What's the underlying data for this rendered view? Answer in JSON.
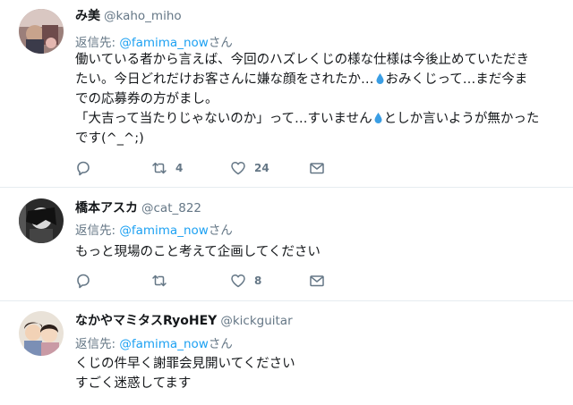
{
  "tweets": [
    {
      "name": "み美",
      "handle": "@kaho_miho",
      "reply_prefix": "返信先: ",
      "reply_to": "@famima_now",
      "reply_suffix": "さん",
      "lines": [
        "働いている者から言えば、今回のハズレくじの様な仕様は今後止めていただき",
        "たい。今日どれだけお客さんに嫌な顔をされたか…",
        "おみくじって…まだ今ま",
        "での応募券の方がまし。",
        "「大吉って当たりじゃないのか」って…すいません",
        "としか言いようが無かった",
        "です(^_^;)"
      ],
      "retweets": "4",
      "likes": "24"
    },
    {
      "name": "橋本アスカ",
      "handle": "@cat_822",
      "reply_prefix": "返信先: ",
      "reply_to": "@famima_now",
      "reply_suffix": "さん",
      "lines": [
        "もっと現場のこと考えて企画してください"
      ],
      "retweets": "",
      "likes": "8"
    },
    {
      "name": "なかやマミタスRyoHEY",
      "handle": "@kickguitar",
      "reply_prefix": "返信先: ",
      "reply_to": "@famima_now",
      "reply_suffix": "さん",
      "lines": [
        "くじの件早く謝罪会見開いてください",
        "すごく迷惑してます"
      ]
    }
  ],
  "icons": {
    "reply": "reply-icon",
    "retweet": "retweet-icon",
    "like": "heart-icon",
    "dm": "envelope-icon",
    "emoji": "droplet-emoji"
  },
  "colors": {
    "link": "#1da1f2",
    "muted": "#657786",
    "text": "#14171a",
    "divider": "#e6ecf0"
  }
}
